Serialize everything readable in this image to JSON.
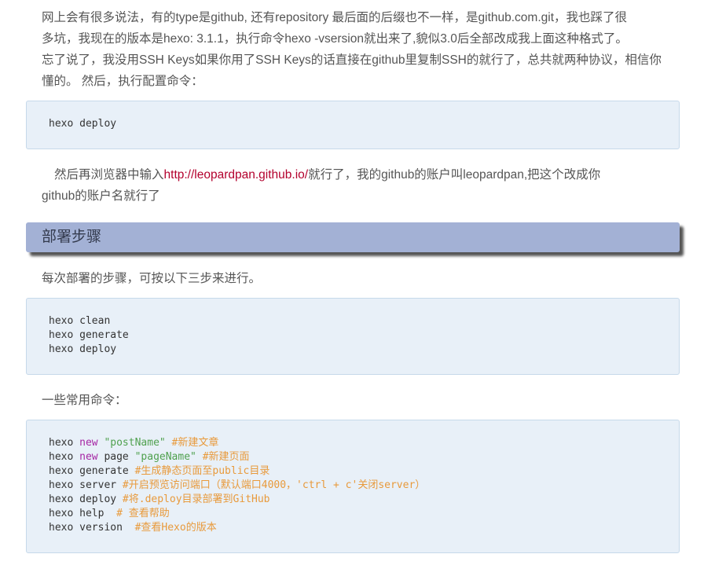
{
  "intro": {
    "line1": "网上会有很多说法，有的type是github, 还有repository 最后面的后缀也不一样，是github.com.git，我也踩了很",
    "line2": "多坑，我现在的版本是hexo: 3.1.1，执行命令hexo -vsersion就出来了,貌似3.0后全部改成我上面这种格式了。",
    "line3": "忘了说了，我没用SSH Keys如果你用了SSH Keys的话直接在github里复制SSH的就行了，总共就两种协议，相信你",
    "line4": "懂的。 然后，执行配置命令："
  },
  "code_deploy": {
    "line1": "hexo deploy"
  },
  "browse": {
    "prefix": "然后再浏览器中输入",
    "link": "http://leopardpan.github.io/",
    "suffix": "就行了，我的github的账户叫leopardpan,把这个改成你",
    "line2": "github的账户名就行了"
  },
  "section": {
    "title": "部署步骤"
  },
  "steps_intro": "每次部署的步骤，可按以下三步来进行。",
  "code_steps": {
    "line1": "hexo clean",
    "line2": "hexo generate",
    "line3": "hexo deploy"
  },
  "common_intro": "一些常用命令：",
  "code_common": {
    "l1_cmd": "hexo ",
    "l1_kw": "new",
    "l1_str": " \"postName\"",
    "l1_cmt": " #新建文章",
    "l2_cmd": "hexo ",
    "l2_kw": "new",
    "l2_mid": " page ",
    "l2_str": "\"pageName\"",
    "l2_cmt": " #新建页面",
    "l3_cmd": "hexo generate ",
    "l3_cmt": "#生成静态页面至public目录",
    "l4_cmd": "hexo server ",
    "l4_cmt": "#开启预览访问端口（默认端口4000，'ctrl + c'关闭server）",
    "l5_cmd": "hexo deploy ",
    "l5_cmt": "#将.deploy目录部署到GitHub",
    "l6_cmd": "hexo help  ",
    "l6_cmt": "# 查看帮助",
    "l7_cmd": "hexo version  ",
    "l7_cmt": "#查看Hexo的版本"
  },
  "colors": {
    "text": "#555555",
    "link": "#b3002d",
    "code_bg": "#e8f0f8",
    "heading_bg": "#a3b1d5",
    "keyword": "#a626a4",
    "string": "#50a14f",
    "comment": "#e89a3c"
  }
}
